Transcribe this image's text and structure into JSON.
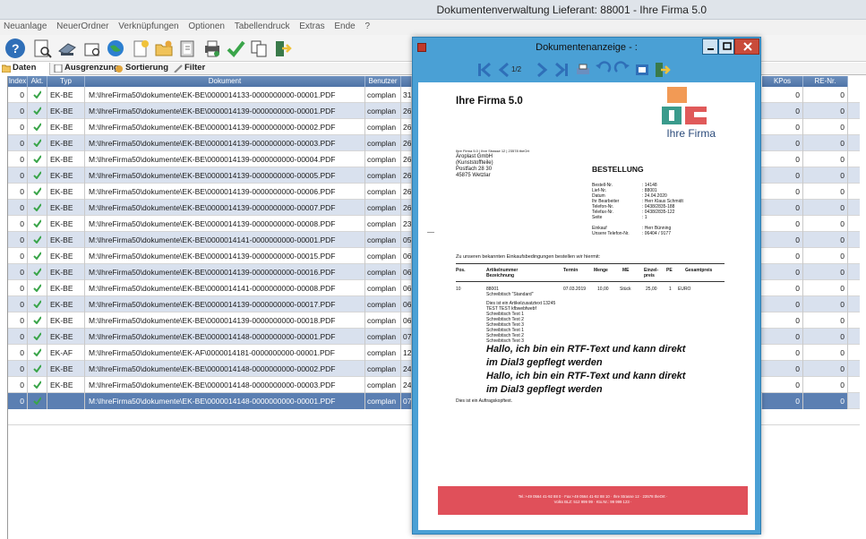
{
  "window": {
    "title": "Dokumentenverwaltung Lieferant: 88001 - Ihre Firma 5.0"
  },
  "menu": [
    "Neuanlage",
    "NeuerOrdner",
    "Verknüpfungen",
    "Optionen",
    "Tabellendruck",
    "Extras",
    "Ende",
    "?"
  ],
  "toolbar_icons": [
    "help-icon",
    "preview-icon",
    "scanner-icon",
    "print-icon",
    "globe-icon",
    "document-new-icon",
    "folder-open-icon",
    "clipboard-icon",
    "printer-icon",
    "checkmark-icon",
    "copy-icon",
    "exit-icon"
  ],
  "tabs": [
    {
      "label": "Daten",
      "icon": "folder-icon"
    },
    {
      "label": "Ausgrenzung",
      "icon": "page-icon"
    },
    {
      "label": "Sortierung",
      "icon": "sort-icon"
    },
    {
      "label": "Filter",
      "icon": "filter-icon"
    }
  ],
  "columns": {
    "index": "Index",
    "akt": "Akt.",
    "typ": "Typ",
    "dokument": "Dokument",
    "benutzer": "Benutzer",
    "kpos": "KPos",
    "re_nr": "RE-Nr."
  },
  "rows": [
    {
      "index": "0",
      "typ": "EK-BE",
      "dokument": "M:\\IhreFirma50\\dokumente\\EK-BE\\0000014133-0000000000-00001.PDF",
      "benutzer": "complan",
      "extra": "31",
      "kpos": "0",
      "re_nr": "0"
    },
    {
      "index": "0",
      "typ": "EK-BE",
      "dokument": "M:\\IhreFirma50\\dokumente\\EK-BE\\0000014139-0000000000-00001.PDF",
      "benutzer": "complan",
      "extra": "26",
      "kpos": "0",
      "re_nr": "0"
    },
    {
      "index": "0",
      "typ": "EK-BE",
      "dokument": "M:\\IhreFirma50\\dokumente\\EK-BE\\0000014139-0000000000-00002.PDF",
      "benutzer": "complan",
      "extra": "26",
      "kpos": "0",
      "re_nr": "0"
    },
    {
      "index": "0",
      "typ": "EK-BE",
      "dokument": "M:\\IhreFirma50\\dokumente\\EK-BE\\0000014139-0000000000-00003.PDF",
      "benutzer": "complan",
      "extra": "26",
      "kpos": "0",
      "re_nr": "0"
    },
    {
      "index": "0",
      "typ": "EK-BE",
      "dokument": "M:\\IhreFirma50\\dokumente\\EK-BE\\0000014139-0000000000-00004.PDF",
      "benutzer": "complan",
      "extra": "26",
      "kpos": "0",
      "re_nr": "0"
    },
    {
      "index": "0",
      "typ": "EK-BE",
      "dokument": "M:\\IhreFirma50\\dokumente\\EK-BE\\0000014139-0000000000-00005.PDF",
      "benutzer": "complan",
      "extra": "26",
      "kpos": "0",
      "re_nr": "0"
    },
    {
      "index": "0",
      "typ": "EK-BE",
      "dokument": "M:\\IhreFirma50\\dokumente\\EK-BE\\0000014139-0000000000-00006.PDF",
      "benutzer": "complan",
      "extra": "26",
      "kpos": "0",
      "re_nr": "0"
    },
    {
      "index": "0",
      "typ": "EK-BE",
      "dokument": "M:\\IhreFirma50\\dokumente\\EK-BE\\0000014139-0000000000-00007.PDF",
      "benutzer": "complan",
      "extra": "26",
      "kpos": "0",
      "re_nr": "0"
    },
    {
      "index": "0",
      "typ": "EK-BE",
      "dokument": "M:\\IhreFirma50\\dokumente\\EK-BE\\0000014139-0000000000-00008.PDF",
      "benutzer": "complan",
      "extra": "23",
      "kpos": "0",
      "re_nr": "0"
    },
    {
      "index": "0",
      "typ": "EK-BE",
      "dokument": "M:\\IhreFirma50\\dokumente\\EK-BE\\0000014141-0000000000-00001.PDF",
      "benutzer": "complan",
      "extra": "05",
      "kpos": "0",
      "re_nr": "0"
    },
    {
      "index": "0",
      "typ": "EK-BE",
      "dokument": "M:\\IhreFirma50\\dokumente\\EK-BE\\0000014139-0000000000-00015.PDF",
      "benutzer": "complan",
      "extra": "06",
      "kpos": "0",
      "re_nr": "0"
    },
    {
      "index": "0",
      "typ": "EK-BE",
      "dokument": "M:\\IhreFirma50\\dokumente\\EK-BE\\0000014139-0000000000-00016.PDF",
      "benutzer": "complan",
      "extra": "06",
      "kpos": "0",
      "re_nr": "0"
    },
    {
      "index": "0",
      "typ": "EK-BE",
      "dokument": "M:\\IhreFirma50\\dokumente\\EK-BE\\0000014141-0000000000-00008.PDF",
      "benutzer": "complan",
      "extra": "06",
      "kpos": "0",
      "re_nr": "0"
    },
    {
      "index": "0",
      "typ": "EK-BE",
      "dokument": "M:\\IhreFirma50\\dokumente\\EK-BE\\0000014139-0000000000-00017.PDF",
      "benutzer": "complan",
      "extra": "06",
      "kpos": "0",
      "re_nr": "0"
    },
    {
      "index": "0",
      "typ": "EK-BE",
      "dokument": "M:\\IhreFirma50\\dokumente\\EK-BE\\0000014139-0000000000-00018.PDF",
      "benutzer": "complan",
      "extra": "06",
      "kpos": "0",
      "re_nr": "0"
    },
    {
      "index": "0",
      "typ": "EK-BE",
      "dokument": "M:\\IhreFirma50\\dokumente\\EK-BE\\0000014148-0000000000-00001.PDF",
      "benutzer": "complan",
      "extra": "07",
      "kpos": "0",
      "re_nr": "0"
    },
    {
      "index": "0",
      "typ": "EK-AF",
      "dokument": "M:\\IhreFirma50\\dokumente\\EK-AF\\0000014181-0000000000-00001.PDF",
      "benutzer": "complan",
      "extra": "12",
      "kpos": "0",
      "re_nr": "0"
    },
    {
      "index": "0",
      "typ": "EK-BE",
      "dokument": "M:\\IhreFirma50\\dokumente\\EK-BE\\0000014148-0000000000-00002.PDF",
      "benutzer": "complan",
      "extra": "24",
      "kpos": "0",
      "re_nr": "0"
    },
    {
      "index": "0",
      "typ": "EK-BE",
      "dokument": "M:\\IhreFirma50\\dokumente\\EK-BE\\0000014148-0000000000-00003.PDF",
      "benutzer": "complan",
      "extra": "24",
      "kpos": "0",
      "re_nr": "0"
    },
    {
      "index": "0",
      "typ": "",
      "dokument": "M:\\IhreFirma50\\dokumente\\EK-BE\\0000014148-0000000000-00001.PDF",
      "benutzer": "complan",
      "extra": "07",
      "kpos": "0",
      "re_nr": "0",
      "selected": true
    }
  ],
  "viewer": {
    "title": "Dokumentenanzeige - :",
    "page_indicator": "1/2",
    "company": "Ihre Firma 5.0",
    "logo_text": "Ihre Firma",
    "sender_line": "Ihre Firma 5.0 | Ihre Strasse 12 | 23578 theOrt",
    "address": [
      "Äroplast GmbH",
      "(Kunststoffteile)",
      "Postfach 28 30",
      "45875 Wetzlar"
    ],
    "doc_type": "BESTELLUNG",
    "meta_labels": [
      "Bestell-Nr.",
      "Lief-Nr.",
      "Datum",
      "Ihr Bearbeiter",
      "Telefon-Nr.",
      "Telefax-Nr.",
      "Seite"
    ],
    "meta_values": [
      ": 14148",
      ": 88001",
      ": 24.04.2020",
      ": Herr Klaus Schmidt",
      ": 0438/2835-188",
      ": 0438/2835-122",
      ": 1"
    ],
    "einkauf_labels": [
      "Einkauf",
      "Unsere Telefon-Nr."
    ],
    "einkauf_values": [
      ": Herr Bünning",
      ": 06404 / 9177"
    ],
    "intro": "Zu unseren bekannten Einkaufsbedingungen bestellen wir hiermit:",
    "table_head": {
      "pos": "Pos.",
      "artnr": "Artikelnummer",
      "bez": "Bezeichnung",
      "termin": "Termin",
      "menge": "Menge",
      "me": "ME",
      "einzel": "Einzel-",
      "preis": "preis",
      "pe": "PE",
      "gesamt": "Gesamtpreis"
    },
    "item": {
      "pos": "10",
      "artnr": "88001",
      "termin": "07.03.2019",
      "menge": "10,00",
      "me": "Stück",
      "einzel": "25,00",
      "pe": "1",
      "waehrung": "EURO"
    },
    "item_lines": [
      "Schreibtisch \"Standard\"",
      "Dies ist ein Artikelzusatztext 13245",
      "TEST TEST kfbwebfwebf",
      "Schreibtisch Text 1",
      "Schreibtisch Text 2",
      "Schreibtisch Text 3",
      "Schreibtisch Text 1",
      "Schreibtisch Text 2",
      "Schreibtisch Text 3"
    ],
    "rtf_lines": [
      "Hallo, ich bin ein RTF-Text und kann direkt",
      "im Dial3 gepflegt werden",
      "Hallo, ich bin ein RTF-Text und kann direkt",
      "im Dial3 gepflegt werden"
    ],
    "footer_note": "Dies ist ein Auftragskopftext.",
    "footer_line1": "Tel.:+49 0564 41-92 88 0 · Fax:+49 0564 41-92 88 10 · Ihre Strasse 12 · 23578 theOrt ·",
    "footer_line2": "Volks BLZ: 512 999 99 · Kto.Nr.: 99 999 123 ·"
  },
  "colors": {
    "header_blue": "#5578a9",
    "row_alt": "#d9e1ee",
    "viewer_frame": "#4aa0d5",
    "footer_red": "#e0505a",
    "logo_orange": "#f29a55",
    "logo_teal": "#3a9b8c",
    "logo_red": "#e05a5a"
  }
}
